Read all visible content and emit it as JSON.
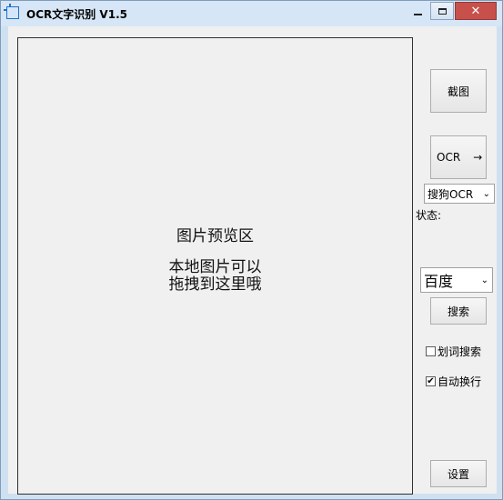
{
  "window": {
    "title": "OCR文字识别 V1.5",
    "minimize_icon": "minimize-icon",
    "maximize_icon": "maximize-icon",
    "close_icon": "close-icon",
    "close_glyph": "✕"
  },
  "preview": {
    "title": "图片预览区",
    "hint_line1": "本地图片可以",
    "hint_line2": "拖拽到这里哦"
  },
  "controls": {
    "capture_label": "截图",
    "ocr_label": "OCR",
    "ocr_arrow": "→",
    "engine_selected": "搜狗OCR",
    "status_label": "状态:",
    "search_engine_selected": "百度",
    "search_label": "搜索",
    "word_search_label": "划词搜索",
    "word_search_checked": false,
    "auto_wrap_label": "自动换行",
    "auto_wrap_checked": true,
    "settings_label": "设置"
  },
  "colors": {
    "accent": "#1e73c8",
    "close_button": "#c7504b",
    "titlebar": "#d6e6f7",
    "client_bg": "#f0f0f0"
  }
}
